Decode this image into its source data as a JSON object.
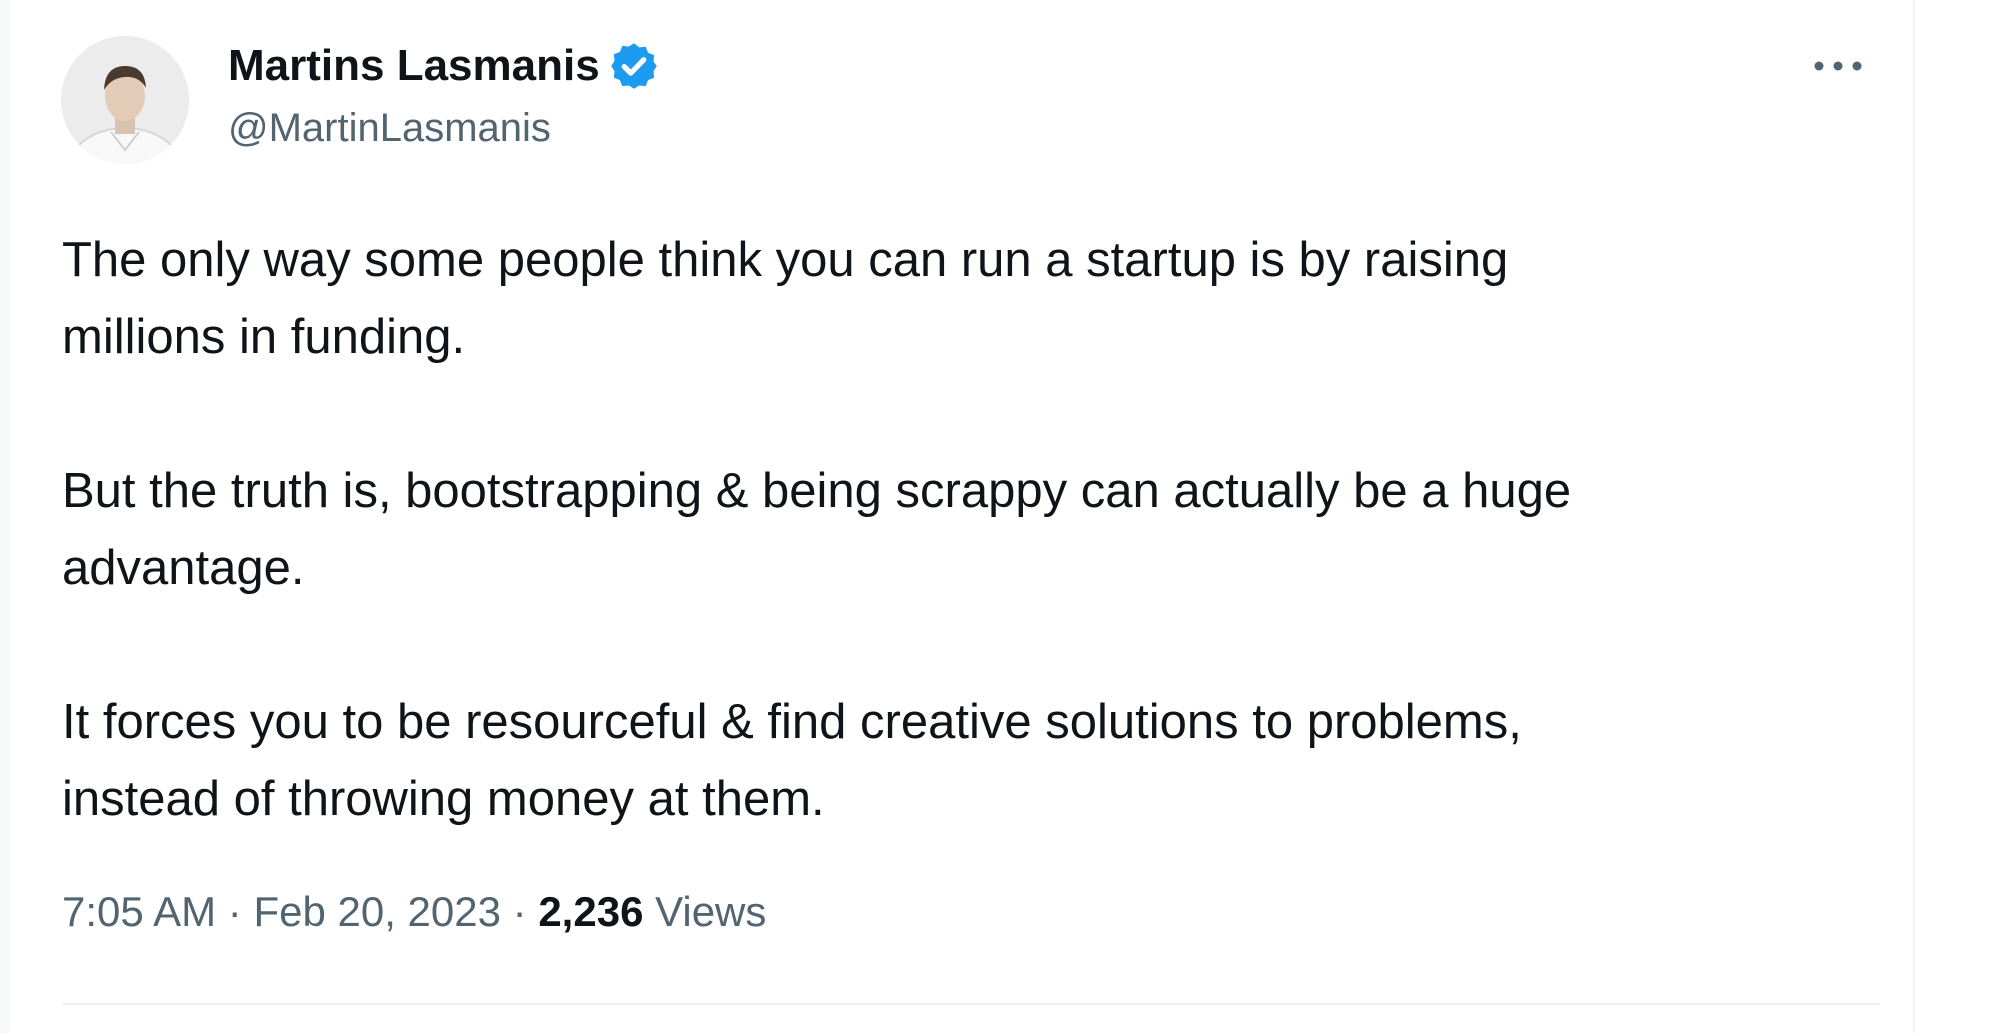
{
  "tweet": {
    "author": {
      "display_name": "Martins Lasmanis",
      "handle": "@MartinLasmanis",
      "verified_color": "#1d9bf0"
    },
    "paragraphs": [
      "The only way some people think you can run a startup is by raising\nmillions in funding.",
      "But the truth is, bootstrapping & being scrappy can actually be a huge\nadvantage.",
      "It forces you to be resourceful & find creative solutions to problems,\ninstead of throwing money at them."
    ],
    "time": "7:05 AM",
    "separator": "·",
    "date": "Feb 20, 2023",
    "views_count": "2,236",
    "views_label": "Views"
  }
}
